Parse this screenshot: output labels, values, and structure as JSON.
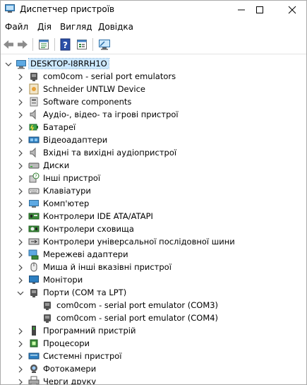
{
  "window": {
    "title": "Диспетчер пристроїв"
  },
  "menu": [
    "Файл",
    "Дія",
    "Вигляд",
    "Довідка"
  ],
  "toolbar": {
    "buttons": [
      "back-arrow-icon",
      "forward-arrow-icon",
      "properties-icon",
      "help-icon",
      "view-list-icon",
      "monitor-scan-icon"
    ]
  },
  "tree": {
    "root": "DESKTOP-I8RRH1O",
    "items": [
      {
        "label": "com0com - serial port emulators",
        "icon": "port-icon"
      },
      {
        "label": "Schneider UNTLW Device",
        "icon": "schneider-device-icon"
      },
      {
        "label": "Software components",
        "icon": "software-component-icon"
      },
      {
        "label": "Аудіо-, відео- та ігрові пристрої",
        "icon": "speaker-icon"
      },
      {
        "label": "Батареї",
        "icon": "battery-icon"
      },
      {
        "label": "Відеоадаптери",
        "icon": "display-adapter-icon"
      },
      {
        "label": "Вхідні та вихідні аудіопристрої",
        "icon": "speaker-icon"
      },
      {
        "label": "Диски",
        "icon": "disk-drive-icon"
      },
      {
        "label": "Інші пристрої",
        "icon": "unknown-device-icon"
      },
      {
        "label": "Клавіатури",
        "icon": "keyboard-icon"
      },
      {
        "label": "Комп'ютер",
        "icon": "computer-icon"
      },
      {
        "label": "Контролери IDE ATA/ATAPI",
        "icon": "ide-controller-icon"
      },
      {
        "label": "Контролери сховища",
        "icon": "storage-controller-icon"
      },
      {
        "label": "Контролери універсальної послідовної шини",
        "icon": "usb-icon"
      },
      {
        "label": "Мережеві адаптери",
        "icon": "network-adapter-icon"
      },
      {
        "label": "Миша й інші вказівні пристрої",
        "icon": "mouse-icon"
      },
      {
        "label": "Монітори",
        "icon": "monitor-icon"
      },
      {
        "label": "Порти (COM та LPT)",
        "icon": "port-icon",
        "expanded": true,
        "children": [
          {
            "label": "com0com - serial port emulator (COM3)",
            "icon": "port-icon"
          },
          {
            "label": "com0com - serial port emulator (COM4)",
            "icon": "port-icon"
          }
        ]
      },
      {
        "label": "Програмний пристрій",
        "icon": "software-device-icon"
      },
      {
        "label": "Процесори",
        "icon": "processor-icon"
      },
      {
        "label": "Системні пристрої",
        "icon": "system-device-icon"
      },
      {
        "label": "Фотокамери",
        "icon": "camera-icon"
      },
      {
        "label": "Черги друку",
        "icon": "printer-icon"
      }
    ]
  }
}
